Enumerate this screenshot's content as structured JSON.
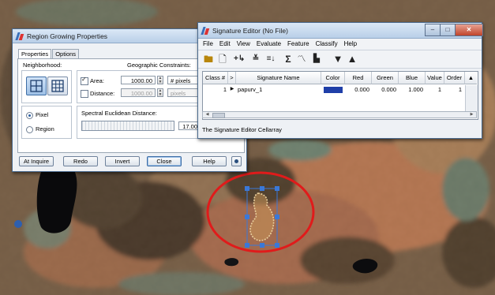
{
  "region_growing": {
    "title": "Region Growing Properties",
    "tabs": [
      "Properties",
      "Options"
    ],
    "neighborhood_label": "Neighborhood:",
    "geo_constraints_label": "Geographic Constraints:",
    "area": {
      "label": "Area:",
      "checked": true,
      "value": "1000.00",
      "unit": "# pixels"
    },
    "distance": {
      "label": "Distance:",
      "checked": false,
      "value": "1000.00",
      "unit": "pixels"
    },
    "pixel_label": "Pixel",
    "region_label": "Region",
    "spectral_label": "Spectral Euclidean Distance:",
    "spectral_value": "17.00",
    "buttons": {
      "inquire": "At Inquire",
      "redo": "Redo",
      "invert": "Invert",
      "close": "Close",
      "help": "Help"
    }
  },
  "signature_editor": {
    "title": "Signature Editor (No File)",
    "window_controls": {
      "minimize": "–",
      "maximize": "□",
      "close": "✕"
    },
    "menu": [
      "File",
      "Edit",
      "View",
      "Evaluate",
      "Feature",
      "Classify",
      "Help"
    ],
    "toolbar_icons": [
      "open-folder-icon",
      "new-file-icon",
      "add-signature-icon",
      "merge-icon",
      "sort-icon",
      "sum-icon",
      "signature-plot-icon",
      "histogram-icon",
      "arrow-down-icon",
      "arrow-up-icon"
    ],
    "columns": [
      "Class #",
      ">",
      "Signature Name",
      "Color",
      "Red",
      "Green",
      "Blue",
      "Value",
      "Order"
    ],
    "rows": [
      {
        "class": "1",
        "marker": "▶",
        "name": "papurv_1",
        "color": "#1f3fa8",
        "red": "0.000",
        "green": "0.000",
        "blue": "1.000",
        "value": "1",
        "order": "1"
      }
    ],
    "status": "The Signature Editor Cellarray"
  },
  "colors": {
    "annotation_ellipse": "#e01b1b",
    "selection_handles": "#3a78d8",
    "seed_region": "#d6a86a"
  }
}
